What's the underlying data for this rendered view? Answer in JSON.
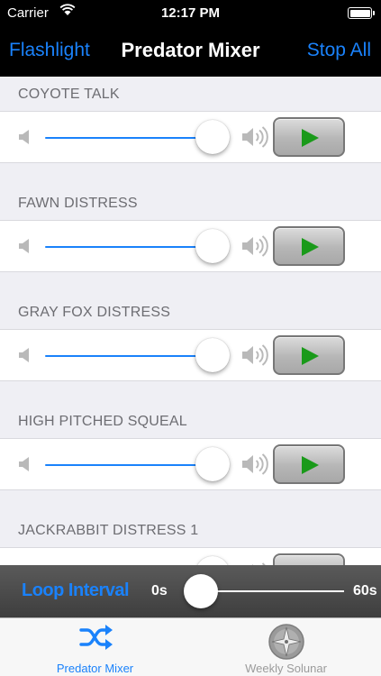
{
  "status_bar": {
    "carrier": "Carrier",
    "time": "12:17 PM"
  },
  "nav": {
    "left_button": "Flashlight",
    "title": "Predator Mixer",
    "right_button": "Stop All"
  },
  "sounds": [
    {
      "name": "COYOTE TALK",
      "volume": 1.0
    },
    {
      "name": "FAWN DISTRESS",
      "volume": 1.0
    },
    {
      "name": "GRAY FOX DISTRESS",
      "volume": 1.0
    },
    {
      "name": "HIGH PITCHED SQUEAL",
      "volume": 1.0
    },
    {
      "name": "JACKRABBIT DISTRESS 1",
      "volume": 1.0
    }
  ],
  "loop_interval": {
    "label": "Loop Interval",
    "min_label": "0s",
    "max_label": "60s",
    "value_seconds": 0
  },
  "tabs": [
    {
      "label": "Predator Mixer",
      "icon": "shuffle-icon",
      "selected": true
    },
    {
      "label": "Weekly Solunar",
      "icon": "compass-icon",
      "selected": false
    }
  ],
  "colors": {
    "accent": "#1a82fb",
    "play": "#1a9a1a",
    "bar_background": "#000000"
  }
}
